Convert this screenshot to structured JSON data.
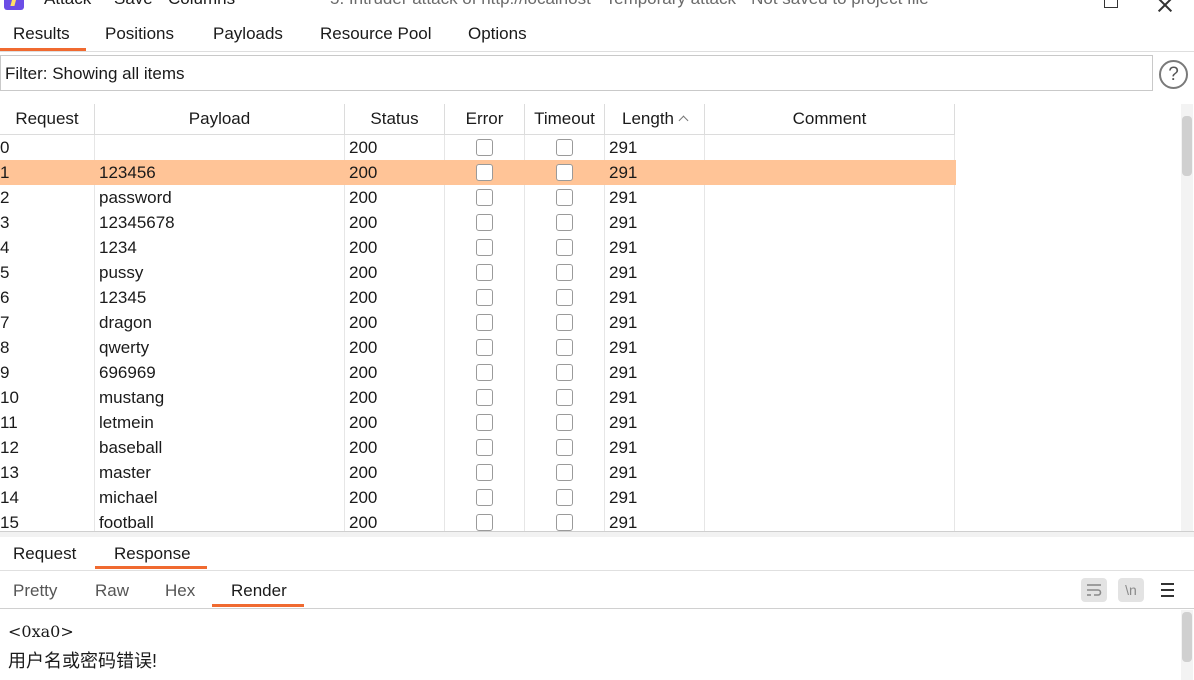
{
  "titlebar": {
    "menu": [
      "Attack",
      "Save",
      "Columns"
    ],
    "window_title": "5. Intruder attack of http://localhost - Temporary attack - Not saved to project file"
  },
  "main_tabs": [
    "Results",
    "Positions",
    "Payloads",
    "Resource Pool",
    "Options"
  ],
  "active_main_tab": "Results",
  "filter": {
    "text": "Filter: Showing all items",
    "help_label": "?"
  },
  "table": {
    "columns": [
      "Request",
      "Payload",
      "Status",
      "Error",
      "Timeout",
      "Length",
      "Comment"
    ],
    "sorted_column": "Length",
    "sort_direction": "ascending",
    "selected_row": 1,
    "rows": [
      {
        "request": "0",
        "payload": "",
        "status": "200",
        "error": false,
        "timeout": false,
        "length": "291",
        "comment": ""
      },
      {
        "request": "1",
        "payload": "123456",
        "status": "200",
        "error": false,
        "timeout": false,
        "length": "291",
        "comment": ""
      },
      {
        "request": "2",
        "payload": "password",
        "status": "200",
        "error": false,
        "timeout": false,
        "length": "291",
        "comment": ""
      },
      {
        "request": "3",
        "payload": "12345678",
        "status": "200",
        "error": false,
        "timeout": false,
        "length": "291",
        "comment": ""
      },
      {
        "request": "4",
        "payload": "1234",
        "status": "200",
        "error": false,
        "timeout": false,
        "length": "291",
        "comment": ""
      },
      {
        "request": "5",
        "payload": "pussy",
        "status": "200",
        "error": false,
        "timeout": false,
        "length": "291",
        "comment": ""
      },
      {
        "request": "6",
        "payload": "12345",
        "status": "200",
        "error": false,
        "timeout": false,
        "length": "291",
        "comment": ""
      },
      {
        "request": "7",
        "payload": "dragon",
        "status": "200",
        "error": false,
        "timeout": false,
        "length": "291",
        "comment": ""
      },
      {
        "request": "8",
        "payload": "qwerty",
        "status": "200",
        "error": false,
        "timeout": false,
        "length": "291",
        "comment": ""
      },
      {
        "request": "9",
        "payload": "696969",
        "status": "200",
        "error": false,
        "timeout": false,
        "length": "291",
        "comment": ""
      },
      {
        "request": "10",
        "payload": "mustang",
        "status": "200",
        "error": false,
        "timeout": false,
        "length": "291",
        "comment": ""
      },
      {
        "request": "11",
        "payload": "letmein",
        "status": "200",
        "error": false,
        "timeout": false,
        "length": "291",
        "comment": ""
      },
      {
        "request": "12",
        "payload": "baseball",
        "status": "200",
        "error": false,
        "timeout": false,
        "length": "291",
        "comment": ""
      },
      {
        "request": "13",
        "payload": "master",
        "status": "200",
        "error": false,
        "timeout": false,
        "length": "291",
        "comment": ""
      },
      {
        "request": "14",
        "payload": "michael",
        "status": "200",
        "error": false,
        "timeout": false,
        "length": "291",
        "comment": ""
      },
      {
        "request": "15",
        "payload": "football",
        "status": "200",
        "error": false,
        "timeout": false,
        "length": "291",
        "comment": ""
      }
    ]
  },
  "detail_tabs": [
    "Request",
    "Response"
  ],
  "active_detail_tab": "Response",
  "view_tabs": [
    "Pretty",
    "Raw",
    "Hex",
    "Render"
  ],
  "active_view_tab": "Render",
  "toolbar": {
    "wrap_icon": "text-wrap-icon",
    "newline_icon": "\\n",
    "menu_icon": "hamburger-menu-icon"
  },
  "render": {
    "line1": "<0xa0>",
    "line2": "用户名或密码错误!"
  },
  "colors": {
    "accent": "#f06a30",
    "selected_row": "#ffc497",
    "logo": "#6b4de6"
  }
}
